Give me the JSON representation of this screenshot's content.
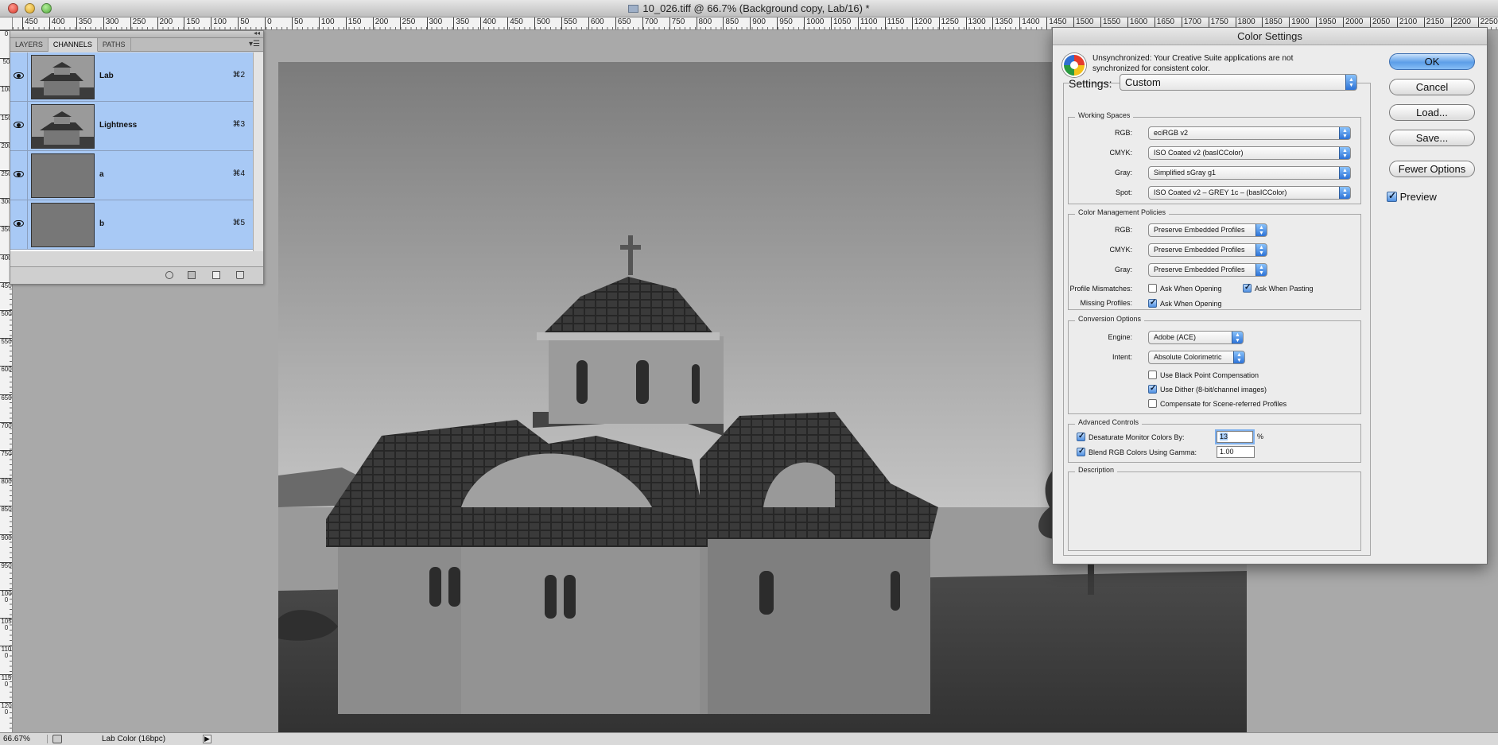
{
  "window": {
    "title": "10_026.tiff @ 66.7% (Background copy, Lab/16) *"
  },
  "ruler": {
    "h_labels": [
      "450",
      "400",
      "350",
      "300",
      "250",
      "200",
      "150",
      "100",
      "50",
      "0",
      "50",
      "100",
      "150",
      "200",
      "250",
      "300",
      "350",
      "400",
      "450",
      "500",
      "550",
      "600",
      "650",
      "700",
      "750",
      "800",
      "850",
      "900",
      "950",
      "1000",
      "1050",
      "1100",
      "1150",
      "1200",
      "1250",
      "1300",
      "1350",
      "1400",
      "1450",
      "1500",
      "1550",
      "1600",
      "1650",
      "1700",
      "1750",
      "1800",
      "1850",
      "1900",
      "1950",
      "2000",
      "2050",
      "2100",
      "2150",
      "2200",
      "2250"
    ],
    "v_labels": [
      "0",
      "50",
      "100",
      "150",
      "200",
      "250",
      "300",
      "350",
      "400",
      "450",
      "500",
      "550",
      "600",
      "650",
      "700",
      "750",
      "800",
      "850",
      "900",
      "950",
      "1000",
      "1050",
      "1100",
      "1150",
      "1200"
    ]
  },
  "channels_panel": {
    "tabs": [
      "LAYERS",
      "CHANNELS",
      "PATHS"
    ],
    "active_tab": "CHANNELS",
    "channels": [
      {
        "name": "Lab",
        "shortcut": "⌘2",
        "thumb": "photo"
      },
      {
        "name": "Lightness",
        "shortcut": "⌘3",
        "thumb": "photo"
      },
      {
        "name": "a",
        "shortcut": "⌘4",
        "thumb": "flat"
      },
      {
        "name": "b",
        "shortcut": "⌘5",
        "thumb": "flat"
      }
    ]
  },
  "dialog": {
    "title": "Color Settings",
    "sync_message": "Unsynchronized: Your Creative Suite applications are not synchronized for consistent color.",
    "buttons": {
      "ok": "OK",
      "cancel": "Cancel",
      "load": "Load...",
      "save": "Save...",
      "fewer": "Fewer Options"
    },
    "preview_label": "Preview",
    "preview_checked": true,
    "settings_label": "Settings:",
    "settings_value": "Custom",
    "working_spaces": {
      "legend": "Working Spaces",
      "rgb_label": "RGB:",
      "rgb": "eciRGB v2",
      "cmyk_label": "CMYK:",
      "cmyk": "ISO Coated v2 (basICColor)",
      "gray_label": "Gray:",
      "gray": "Simplified sGray g1",
      "spot_label": "Spot:",
      "spot": "ISO Coated v2 – GREY 1c – (basICColor)"
    },
    "policies": {
      "legend": "Color Management Policies",
      "rgb_label": "RGB:",
      "rgb": "Preserve Embedded Profiles",
      "cmyk_label": "CMYK:",
      "cmyk": "Preserve Embedded Profiles",
      "gray_label": "Gray:",
      "gray": "Preserve Embedded Profiles",
      "mismatch_label": "Profile Mismatches:",
      "mismatch_open": "Ask When Opening",
      "mismatch_open_checked": false,
      "mismatch_paste": "Ask When Pasting",
      "mismatch_paste_checked": true,
      "missing_label": "Missing Profiles:",
      "missing_open": "Ask When Opening",
      "missing_open_checked": true
    },
    "conversion": {
      "legend": "Conversion Options",
      "engine_label": "Engine:",
      "engine": "Adobe (ACE)",
      "intent_label": "Intent:",
      "intent": "Absolute Colorimetric",
      "bpc": "Use Black Point Compensation",
      "bpc_checked": false,
      "dither": "Use Dither (8-bit/channel images)",
      "dither_checked": true,
      "scene": "Compensate for Scene-referred Profiles",
      "scene_checked": false
    },
    "advanced": {
      "legend": "Advanced Controls",
      "desaturate": "Desaturate Monitor Colors By:",
      "desaturate_checked": true,
      "desaturate_value": "13",
      "desaturate_unit": "%",
      "blend": "Blend RGB Colors Using Gamma:",
      "blend_checked": true,
      "blend_value": "1.00"
    },
    "description": {
      "legend": "Description"
    }
  },
  "status": {
    "zoom": "66.67%",
    "mode": "Lab Color (16bpc)"
  }
}
